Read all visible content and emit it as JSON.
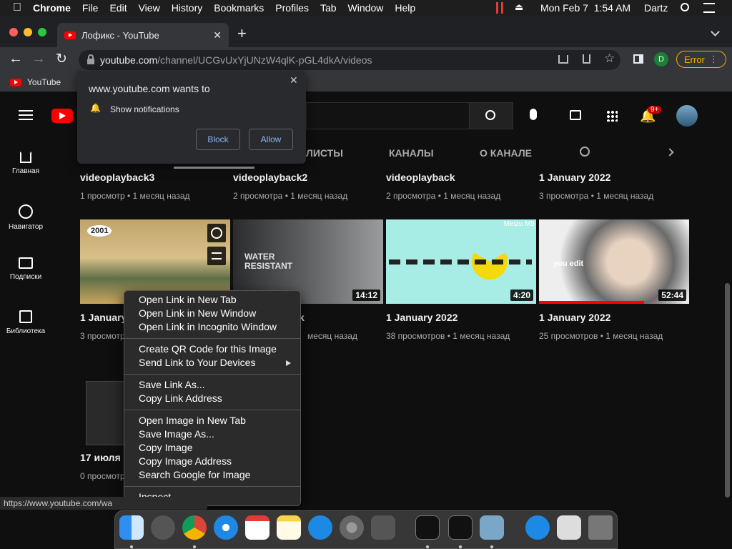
{
  "menubar": {
    "app": "Chrome",
    "items": [
      "File",
      "Edit",
      "View",
      "History",
      "Bookmarks",
      "Profiles",
      "Tab",
      "Window",
      "Help"
    ],
    "datetime": "Mon Feb 7  1:54 AM",
    "user": "Dartz"
  },
  "tab": {
    "title": "Лофикс - YouTube",
    "close": "✕",
    "new": "+"
  },
  "omnibox": {
    "host": "youtube.com",
    "path": "/channel/UCGvUxYjUNzW4qlK-pGL4dkA/videos"
  },
  "toolbar": {
    "profile_initial": "D",
    "error_label": "Error"
  },
  "bookmarks": {
    "items": [
      "YouTube"
    ]
  },
  "sidebar": [
    {
      "label": "Главная"
    },
    {
      "label": "Навигатор"
    },
    {
      "label": "Подписки"
    },
    {
      "label": "Библиотека"
    }
  ],
  "channel_tabs": [
    "ЛИСТЫ",
    "КАНАЛЫ",
    "О КАНАЛЕ"
  ],
  "notif_badge": "9+",
  "popup": {
    "title": "www.youtube.com wants to",
    "permission": "Show notifications",
    "block": "Block",
    "allow": "Allow",
    "close": "✕"
  },
  "row1": [
    {
      "title": "videoplayback3",
      "meta": "1 просмотр • 1 месяц назад"
    },
    {
      "title": "videoplayback2",
      "meta": "2 просмотра • 1 месяц назад"
    },
    {
      "title": "videoplayback",
      "meta": "2 просмотра • 1 месяц назад"
    },
    {
      "title": "1 January 2022",
      "meta": "3 просмотра • 1 месяц назад"
    }
  ],
  "row2": [
    {
      "title": "1 January",
      "meta": "3 просмотр",
      "duration": ""
    },
    {
      "title": "k",
      "meta": "месяц назад",
      "duration": "14:12"
    },
    {
      "title": "1 January 2022",
      "meta": "38 просмотров • 1 месяц назад",
      "duration": "4:20"
    },
    {
      "title": "1 January 2022",
      "meta": "25 просмотров • 1 месяц назад",
      "duration": "52:44"
    }
  ],
  "thumb_texts": {
    "water": "WATER RESISTANT",
    "edit": "you edit",
    "logo2001": "2001",
    "meizu": "Meizu M5"
  },
  "row3": {
    "title": "17 июля 2",
    "meta": "0 просмотр"
  },
  "context_menu": {
    "g1": [
      "Open Link in New Tab",
      "Open Link in New Window",
      "Open Link in Incognito Window"
    ],
    "g2": [
      "Create QR Code for this Image",
      "Send Link to Your Devices"
    ],
    "g3": [
      "Save Link As...",
      "Copy Link Address"
    ],
    "g4": [
      "Open Image in New Tab",
      "Save Image As...",
      "Copy Image",
      "Copy Image Address",
      "Search Google for Image"
    ],
    "g5": [
      "Inspect"
    ]
  },
  "status_url": "https://www.youtube.com/wa",
  "colors": {
    "accent_red": "#ff0000",
    "link_blue": "#8ab4f8",
    "error_orange": "#f9ab00"
  }
}
